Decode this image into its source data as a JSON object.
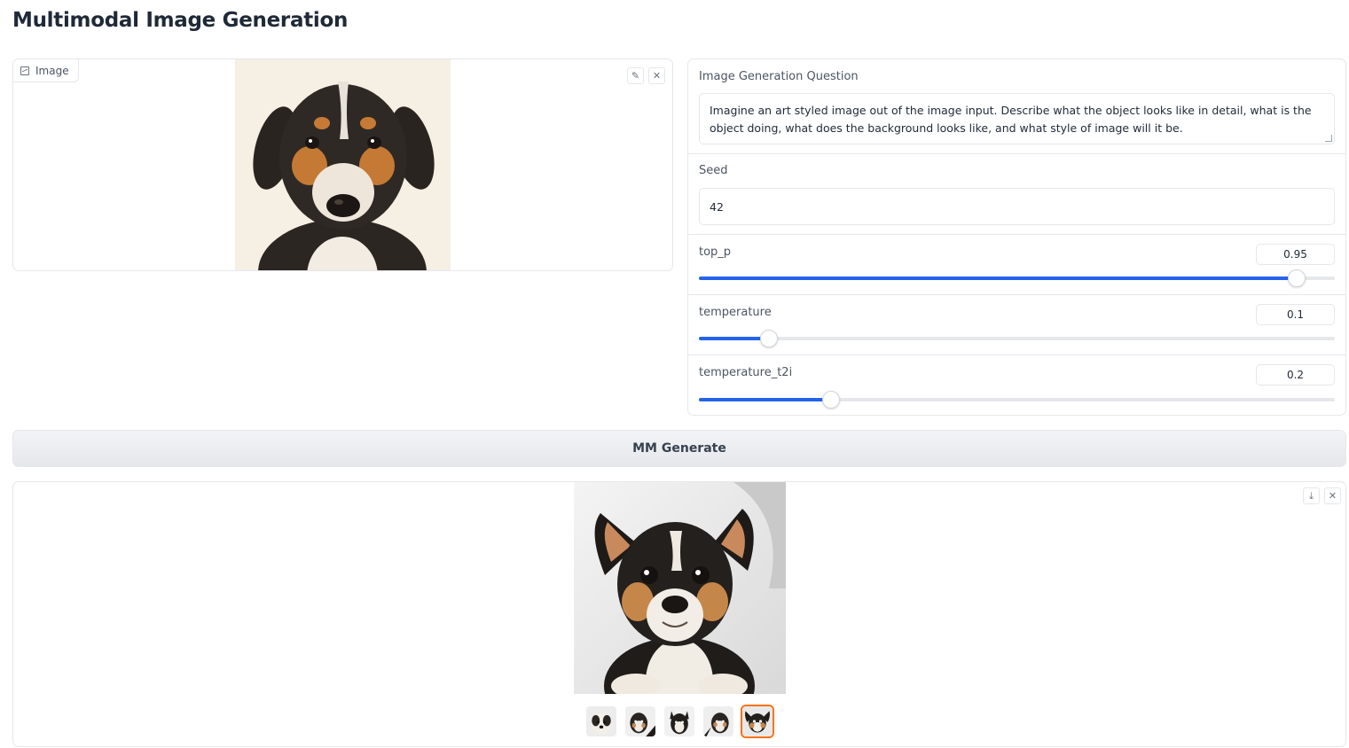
{
  "page": {
    "title": "Multimodal Image Generation"
  },
  "input_image": {
    "label": "Image",
    "icon": "image-icon",
    "content": "puppy-photo"
  },
  "settings": {
    "question": {
      "label": "Image Generation Question",
      "value": "Imagine an art styled image out of the image input. Describe what the object looks like in detail, what is the object doing, what does the background looks like, and what style of image will it be."
    },
    "seed": {
      "label": "Seed",
      "value": "42"
    },
    "top_p": {
      "label": "top_p",
      "value": "0.95",
      "fraction": 0.94
    },
    "temperature": {
      "label": "temperature",
      "value": "0.1",
      "fraction": 0.11
    },
    "temperature_t2i": {
      "label": "temperature_t2i",
      "value": "0.2",
      "fraction": 0.208
    }
  },
  "generate_button": {
    "label": "MM Generate"
  },
  "gallery": {
    "thumbnail_count": 5,
    "selected_index": 4
  },
  "colors": {
    "accent": "#2563eb",
    "selected_border": "#f97316"
  }
}
